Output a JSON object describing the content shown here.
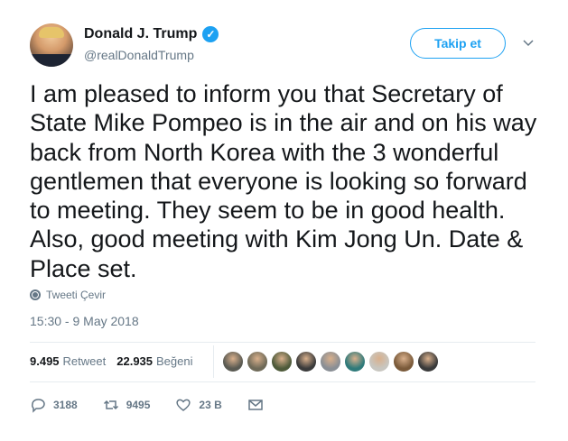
{
  "header": {
    "display_name": "Donald J. Trump",
    "handle": "@realDonaldTrump",
    "follow_label": "Takip et"
  },
  "tweet": {
    "text": "I am pleased to inform you that Secretary of State Mike Pompeo is in the air and on his way back from North Korea with the 3 wonderful gentlemen that everyone is looking so forward to meeting. They seem to be in good health. Also, good meeting with Kim Jong Un. Date & Place set.",
    "translate_label": "Tweeti Çevir",
    "timestamp": "15:30 - 9 May 2018"
  },
  "stats": {
    "retweets_count": "9.495",
    "retweets_label": "Retweet",
    "likes_count": "22.935",
    "likes_label": "Beğeni"
  },
  "liker_avatar_colors": [
    "#5a5a52",
    "#6f6a58",
    "#4e5a3a",
    "#3b3b3b",
    "#8a8f95",
    "#2f7a7a",
    "#c8c6c0",
    "#7a5a3a",
    "#3a3a3a"
  ],
  "actions": {
    "replies": "3188",
    "retweets": "9495",
    "likes": "23 B"
  },
  "colors": {
    "accent": "#1da1f2",
    "muted": "#657786",
    "text": "#14171a"
  }
}
